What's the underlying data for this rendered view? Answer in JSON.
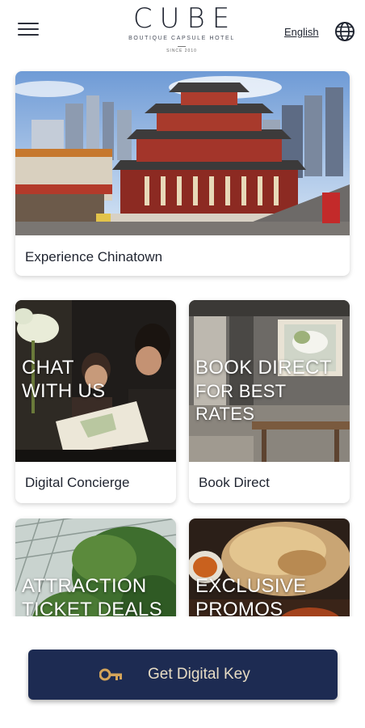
{
  "header": {
    "logo": "CUBE",
    "logo_subtitle": "BOUTIQUE CAPSULE HOTEL",
    "logo_tag": "SINCE 2010",
    "language": "English"
  },
  "cards": {
    "hero": {
      "label": "Experience Chinatown"
    },
    "concierge": {
      "overlay_line1": "CHAT",
      "overlay_line2": "WITH US",
      "label": "Digital Concierge"
    },
    "book": {
      "overlay_line1": "BOOK DIRECT",
      "overlay_line2": "FOR BEST RATES",
      "label": "Book Direct"
    },
    "attraction": {
      "overlay_line1": "ATTRACTION",
      "overlay_line2": "TICKET DEALS"
    },
    "promos": {
      "overlay_line1": "EXCLUSIVE",
      "overlay_line2": "PROMOS"
    }
  },
  "bottom_button": {
    "label": "Get Digital Key",
    "icon": "key-icon"
  },
  "colors": {
    "primary": "#1d2b52",
    "button_text": "#e7dcc4",
    "key_icon": "#d4a45a"
  }
}
